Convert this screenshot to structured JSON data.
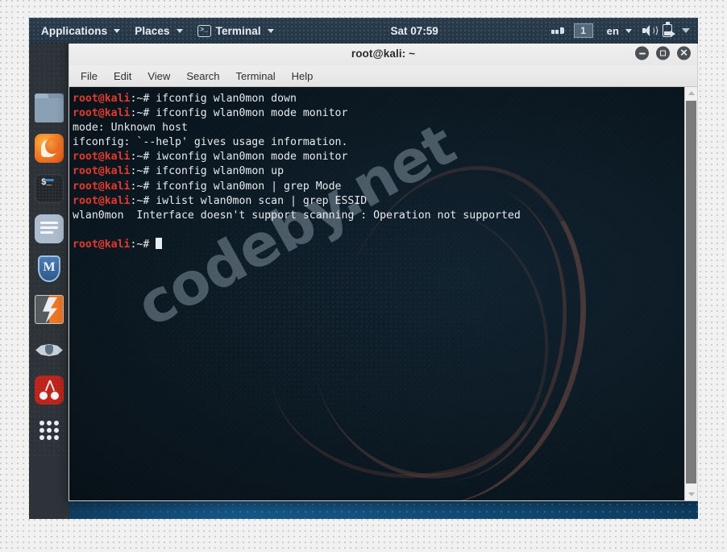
{
  "panel": {
    "applications": "Applications",
    "places": "Places",
    "terminal_menu": "Terminal",
    "terminal_glyph": ">_",
    "clock": "Sat 07:59",
    "workspace": "1",
    "language": "en",
    "icons": {
      "recorder": "screen-recorder-icon",
      "volume": "volume-icon",
      "battery": "battery-charging-icon",
      "system_menu": "system-menu-chevron-icon"
    }
  },
  "dock": {
    "items": [
      {
        "name": "files",
        "label": "Files"
      },
      {
        "name": "firefox",
        "label": "Firefox ESR"
      },
      {
        "name": "terminal",
        "label": "Terminal"
      },
      {
        "name": "text-editor",
        "label": "Text Editor"
      },
      {
        "name": "metasploit",
        "label": "Metasploit Framework",
        "glyph": "M"
      },
      {
        "name": "burpsuite",
        "label": "Burp Suite"
      },
      {
        "name": "wireshark",
        "label": "Wireshark"
      },
      {
        "name": "beef",
        "label": "BeEF"
      },
      {
        "name": "show-applications",
        "label": "Show Applications"
      }
    ]
  },
  "window": {
    "title": "root@kali: ~",
    "menus": [
      "File",
      "Edit",
      "View",
      "Search",
      "Terminal",
      "Help"
    ],
    "buttons": {
      "minimize": "minimize",
      "maximize": "maximize",
      "close": "close"
    }
  },
  "terminal": {
    "prompt_user": "root@kali",
    "prompt_tail": ":~# ",
    "background_watermark": "codeby.net",
    "colors": {
      "background": "#0c1a24",
      "foreground": "#e6ebef",
      "prompt": "#e33a2e"
    },
    "lines": [
      {
        "type": "prompt",
        "command": "ifconfig wlan0mon down"
      },
      {
        "type": "prompt",
        "command": "ifconfig wlan0mon mode monitor"
      },
      {
        "type": "output",
        "text": "mode: Unknown host"
      },
      {
        "type": "output",
        "text": "ifconfig: `--help' gives usage information."
      },
      {
        "type": "prompt",
        "command": "iwconfig wlan0mon mode monitor"
      },
      {
        "type": "prompt",
        "command": "ifconfig wlan0mon up"
      },
      {
        "type": "prompt",
        "command": "ifconfig wlan0mon | grep Mode"
      },
      {
        "type": "prompt",
        "command": "iwlist wlan0mon scan | grep ESSID"
      },
      {
        "type": "output",
        "text": "wlan0mon  Interface doesn't support scanning : Operation not supported"
      },
      {
        "type": "blank",
        "text": ""
      },
      {
        "type": "cursor",
        "command": ""
      }
    ]
  }
}
